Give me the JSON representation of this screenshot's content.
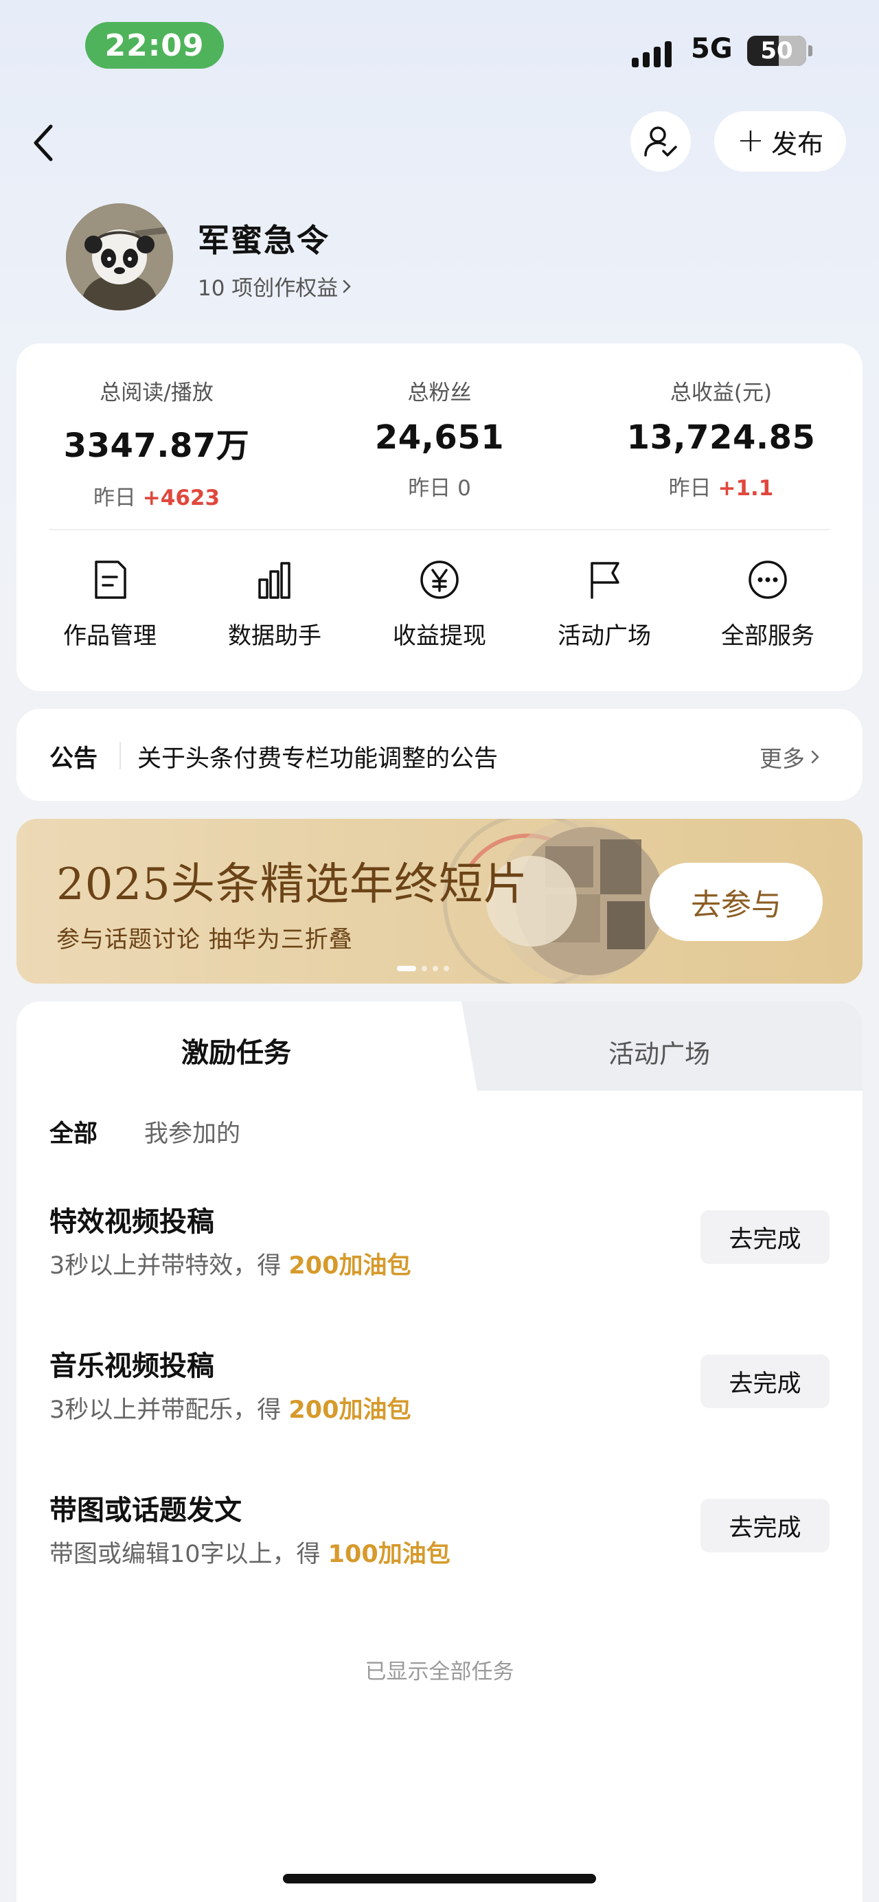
{
  "status_bar": {
    "time": "22:09",
    "network": "5G",
    "battery": "50"
  },
  "nav": {
    "publish_label": "发布",
    "icons": [
      "back-chevron",
      "user-check",
      "plus"
    ]
  },
  "profile": {
    "name": "军蜜急令",
    "rights": "10 项创作权益"
  },
  "stats": [
    {
      "label": "总阅读/播放",
      "value": "3347.87万",
      "delta_prefix": "昨日",
      "delta": "+4623",
      "delta_color": "#e0483d"
    },
    {
      "label": "总粉丝",
      "value": "24,651",
      "delta_prefix": "昨日",
      "delta": "0",
      "delta_color": "#666666"
    },
    {
      "label": "总收益(元)",
      "value": "13,724.85",
      "delta_prefix": "昨日",
      "delta": "+1.1",
      "delta_color": "#e0483d"
    }
  ],
  "tools": [
    {
      "label": "作品管理",
      "icon": "document-icon"
    },
    {
      "label": "数据助手",
      "icon": "bar-chart-icon"
    },
    {
      "label": "收益提现",
      "icon": "yen-icon"
    },
    {
      "label": "活动广场",
      "icon": "flag-icon"
    },
    {
      "label": "全部服务",
      "icon": "more-icon"
    }
  ],
  "announcement": {
    "tag": "公告",
    "text": "关于头条付费专栏功能调整的公告",
    "more": "更多"
  },
  "banner": {
    "title": "2025头条精选年终短片",
    "subtitle": "参与话题讨论 抽华为三折叠",
    "button": "去参与",
    "colors": {
      "text": "#6b4317",
      "bg": "#e6d0a4"
    }
  },
  "tasks": {
    "tabs": [
      "激励任务",
      "活动广场"
    ],
    "filters": [
      "全部",
      "我参加的"
    ],
    "items": [
      {
        "title": "特效视频投稿",
        "desc": "3秒以上并带特效，得 ",
        "reward": "200加油包",
        "button": "去完成"
      },
      {
        "title": "音乐视频投稿",
        "desc": "3秒以上并带配乐，得 ",
        "reward": "200加油包",
        "button": "去完成"
      },
      {
        "title": "带图或话题发文",
        "desc": "带图或编辑10字以上，得 ",
        "reward": "100加油包",
        "button": "去完成"
      }
    ],
    "footer": "已显示全部任务"
  },
  "colors": {
    "accent_red": "#e0483d",
    "reward_gold": "#d69a2c",
    "status_green": "#4fb35b"
  }
}
